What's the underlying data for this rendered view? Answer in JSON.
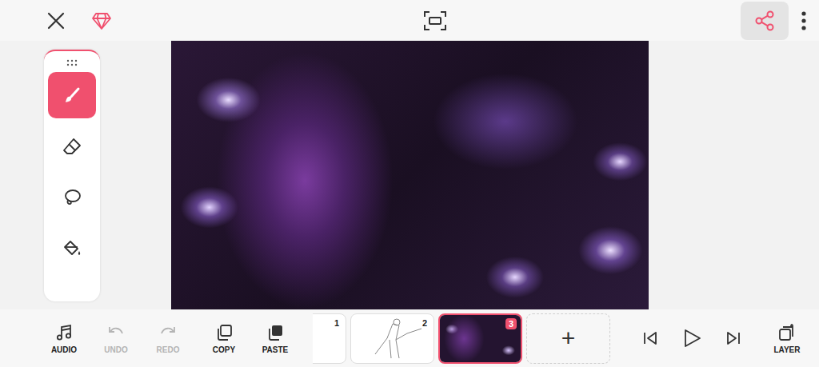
{
  "top_bar": {
    "share_highlighted": true
  },
  "tools": [
    {
      "kind": "brush",
      "selected": true
    },
    {
      "kind": "eraser",
      "selected": false
    },
    {
      "kind": "lasso",
      "selected": false
    },
    {
      "kind": "fill",
      "selected": false
    }
  ],
  "bottom_bar": {
    "actions": [
      {
        "kind": "audio",
        "label": "AUDIO",
        "disabled": false
      },
      {
        "kind": "undo",
        "label": "UNDO",
        "disabled": true
      },
      {
        "kind": "redo",
        "label": "REDO",
        "disabled": true
      },
      {
        "kind": "copy",
        "label": "COPY",
        "disabled": false
      },
      {
        "kind": "paste",
        "label": "PASTE",
        "disabled": false
      }
    ],
    "layer": {
      "label": "LAYER"
    }
  },
  "frames": [
    {
      "number": "1",
      "kind": "blank",
      "selected": false
    },
    {
      "number": "2",
      "kind": "sketch",
      "selected": false
    },
    {
      "number": "3",
      "kind": "painting",
      "selected": true
    }
  ],
  "add_frame": {
    "label": "+"
  }
}
